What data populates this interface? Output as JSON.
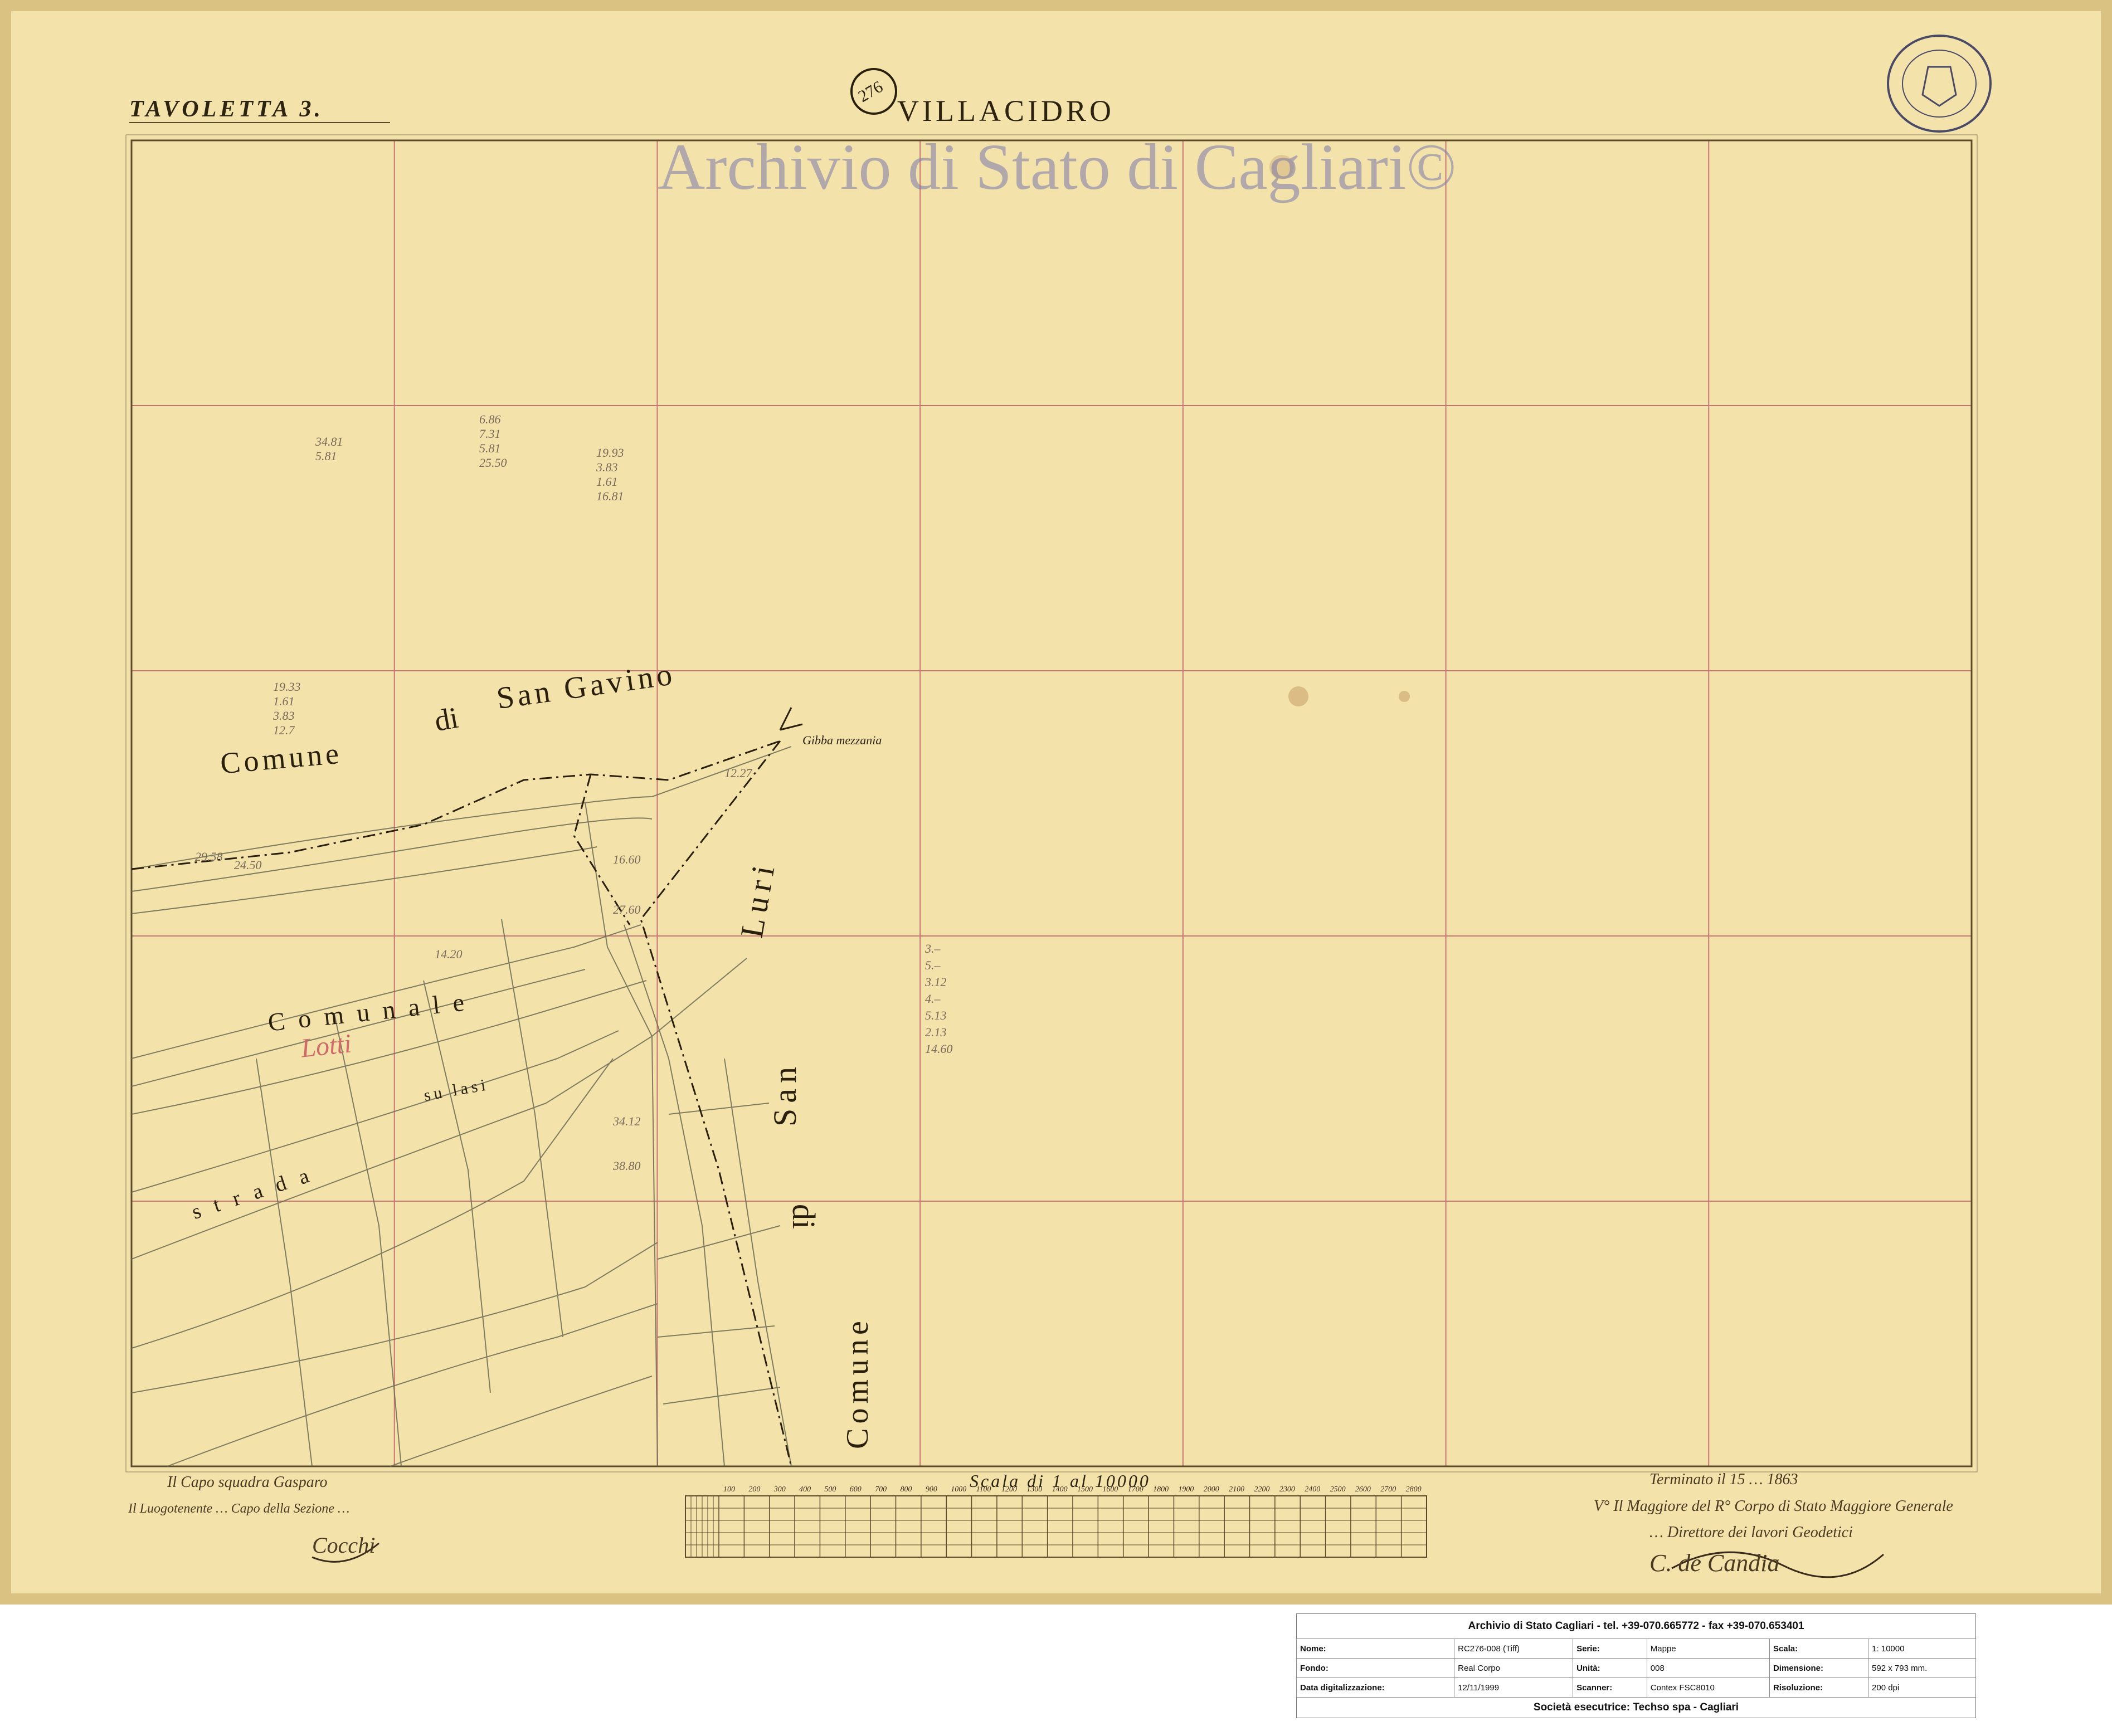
{
  "map": {
    "sheet_label": "TAVOLETTA 3.",
    "title": "VILLACIDRO",
    "watermark": "Archivio di Stato di Cagliari©",
    "stamp_number": "276",
    "scale_title": "Scala di 1 al 10000",
    "scale_ticks": [
      "100",
      "200",
      "300",
      "400",
      "500",
      "600",
      "700",
      "800",
      "900",
      "1000",
      "1100",
      "1200",
      "1300",
      "1400",
      "1500",
      "1600",
      "1700",
      "1800",
      "1900",
      "2000",
      "2100",
      "2200",
      "2300",
      "2400",
      "2500",
      "2600",
      "2700",
      "2800"
    ],
    "place_labels": {
      "comune": "Comune",
      "di": "di",
      "san_gavino": "San Gavino",
      "luri": "Luri",
      "san": "San",
      "di2": "di",
      "comune2": "Comune",
      "comunale": "C o m u n a l e",
      "lotti": "Lotti",
      "strada": "s t r a d a",
      "su_lasi": "su lasi",
      "gibba": "Gibba mezzania"
    },
    "handwritten": {
      "left_1": "Il Capo squadra Gasparo",
      "left_2": "Il Luogotenente  …  Capo della Sezione …",
      "left_3": "Cocchi",
      "right_1": "Terminato il 15 … 1863",
      "right_2": "V° Il Maggiore del R° Corpo di Stato Maggiore Generale",
      "right_3": "… Direttore dei lavori Geodetici",
      "right_4": "C. de Candia"
    },
    "colors": {
      "paper": "#f3e2aa",
      "grid": "#c97575",
      "ink": "#2a1f0c",
      "watermark": "#7878aa"
    }
  },
  "infobox": {
    "header": "Archivio di Stato Cagliari - tel. +39-070.665772 - fax +39-070.653401",
    "rows": [
      [
        {
          "k": "Nome:",
          "v": "RC276-008 (Tiff)"
        },
        {
          "k": "Serie:",
          "v": "Mappe"
        },
        {
          "k": "Scala:",
          "v": "1: 10000"
        }
      ],
      [
        {
          "k": "Fondo:",
          "v": "Real Corpo"
        },
        {
          "k": "Unità:",
          "v": "008"
        },
        {
          "k": "Dimensione:",
          "v": "592 x 793 mm."
        }
      ],
      [
        {
          "k": "Data digitalizzazione:",
          "v": "12/11/1999"
        },
        {
          "k": "Scanner:",
          "v": "Contex FSC8010"
        },
        {
          "k": "Risoluzione:",
          "v": "200 dpi"
        }
      ]
    ],
    "footer": "Società esecutrice: Techso spa - Cagliari"
  }
}
